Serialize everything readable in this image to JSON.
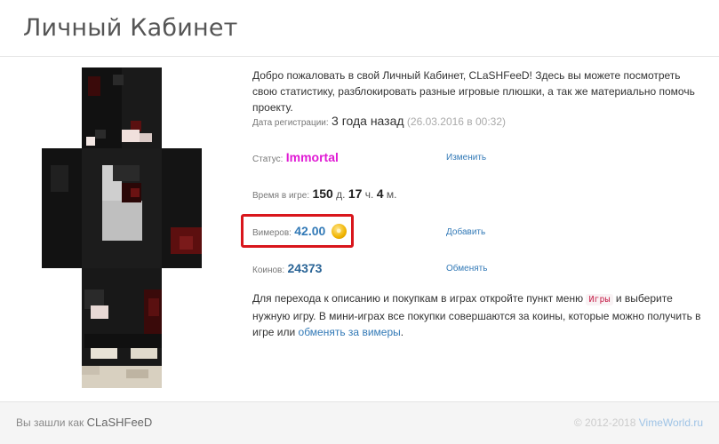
{
  "header": {
    "title": "Личный Кабинет"
  },
  "intro": "Добро пожаловать в свой Личный Кабинет, CLaSHFeeD! Здесь вы можете посмотреть свою статистику, разблокировать разные игровые плюшки, а так же материально помочь проекту.",
  "registration": {
    "label": "Дата регистрации",
    "value": "3 года назад",
    "date": "(26.03.2016 в 00:32)"
  },
  "status": {
    "label": "Статус",
    "value": "Immortal",
    "action": "Изменить"
  },
  "playtime": {
    "label": "Время в игре",
    "days": "150",
    "days_unit": "д.",
    "hours": "17",
    "hours_unit": "ч.",
    "minutes": "4",
    "minutes_unit": "м."
  },
  "vimers": {
    "label": "Вимеров",
    "value": "42.00",
    "action": "Добавить"
  },
  "coins": {
    "label": "Коинов",
    "value": "24373",
    "action": "Обменять"
  },
  "note": {
    "text_before": "Для перехода к описанию и покупкам в играх откройте пункт меню",
    "code": "Игры",
    "text_middle": "и выберите нужную игру. В мини-играх все покупки совершаются за коины, которые можно получить в игре или",
    "link": "обменять за вимеры",
    "text_after": "."
  },
  "footer": {
    "logged_as_label": "Вы зашли как",
    "username": "CLaSHFeeD",
    "copyright": "© 2012-2018",
    "site_link": "VimeWorld.ru"
  },
  "colors": {
    "status": "#e01ad4",
    "link": "#337ab7",
    "highlight": "#d9161c"
  }
}
